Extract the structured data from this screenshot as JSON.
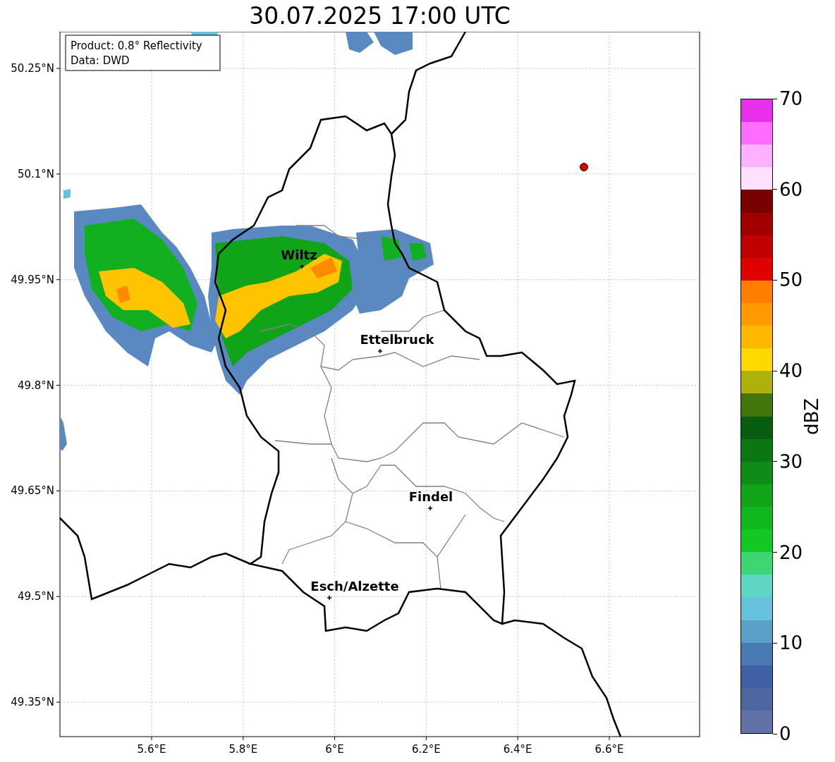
{
  "title": "30.07.2025 17:00 UTC",
  "info_box": {
    "lines": [
      "Product: 0.8° Reflectivity",
      "Data: DWD"
    ]
  },
  "map": {
    "y_ticks": [
      "50.25°N",
      "50.1°N",
      "49.95°N",
      "49.8°N",
      "49.65°N",
      "49.5°N",
      "49.35°N"
    ],
    "x_ticks": [
      "5.6°E",
      "5.8°E",
      "6°E",
      "6.2°E",
      "6.4°E",
      "6.6°E"
    ],
    "cities": [
      {
        "name": "Wiltz"
      },
      {
        "name": "Ettelbruck"
      },
      {
        "name": "Findel"
      },
      {
        "name": "Esch/Alzette"
      }
    ]
  },
  "colorbar": {
    "label": "dBZ",
    "ticks": [
      "70",
      "60",
      "50",
      "40",
      "30",
      "20",
      "10",
      "0"
    ],
    "bins": [
      {
        "color": "#e830ec"
      },
      {
        "color": "#ff6cff"
      },
      {
        "color": "#ffb0ff"
      },
      {
        "color": "#ffe0ff"
      },
      {
        "color": "#780000"
      },
      {
        "color": "#a00000"
      },
      {
        "color": "#c00000"
      },
      {
        "color": "#e00000"
      },
      {
        "color": "#ff7e00"
      },
      {
        "color": "#ff9a00"
      },
      {
        "color": "#ffb800"
      },
      {
        "color": "#ffd800"
      },
      {
        "color": "#b0b00a"
      },
      {
        "color": "#44740c"
      },
      {
        "color": "#085e10"
      },
      {
        "color": "#0b7612"
      },
      {
        "color": "#0e8c18"
      },
      {
        "color": "#10a418"
      },
      {
        "color": "#10b820"
      },
      {
        "color": "#12c822"
      },
      {
        "color": "#3dd672"
      },
      {
        "color": "#5fd6c4"
      },
      {
        "color": "#66c2dc"
      },
      {
        "color": "#5aa0c8"
      },
      {
        "color": "#4a7ab4"
      },
      {
        "color": "#4060a6"
      },
      {
        "color": "#4f67a0"
      },
      {
        "color": "#6272a8"
      }
    ]
  }
}
